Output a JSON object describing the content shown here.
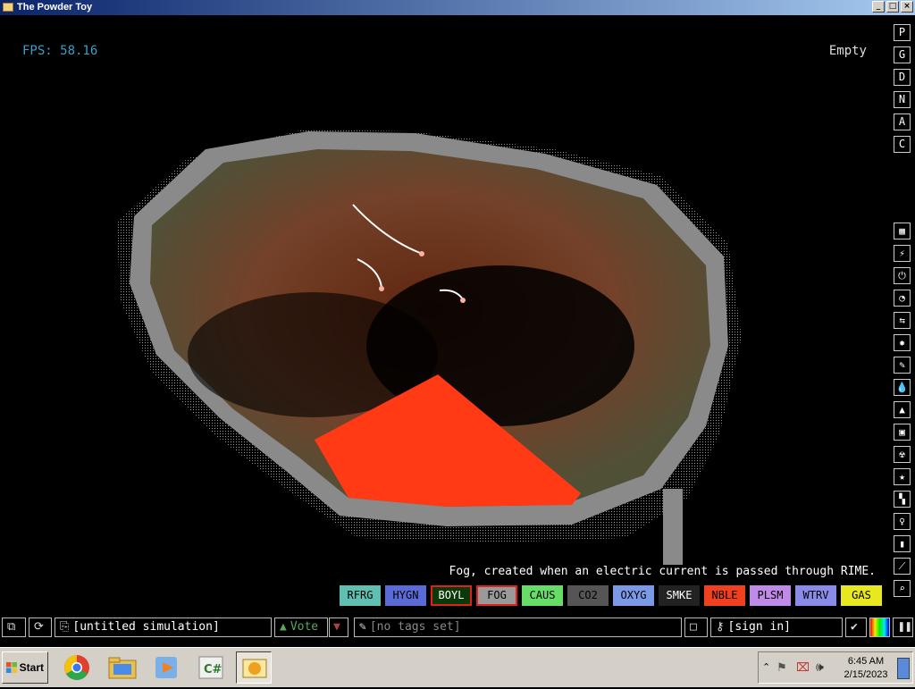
{
  "window": {
    "title": "The Powder Toy",
    "min_label": "_",
    "max_label": "□",
    "close_label": "×"
  },
  "hud": {
    "fps": "FPS: 58.16",
    "status": "Empty"
  },
  "render_modes": [
    "P",
    "G",
    "D",
    "N",
    "A",
    "C"
  ],
  "tool_icons": [
    "walls-icon",
    "electronics-icon",
    "powered-icon",
    "sensors-icon",
    "force-icon",
    "explosives-icon",
    "gases-icon",
    "liquids-icon",
    "powders-icon",
    "solids-icon",
    "radioactive-icon",
    "special-icon",
    "life-icon",
    "tools-icon",
    "favorites-icon",
    "decoration-icon",
    "search-icon"
  ],
  "element_description": {
    "before": "Fog, created when an electric ",
    "underlined": "current",
    "after": " is passed through RIME."
  },
  "elements": [
    {
      "name": "RFRG",
      "color": "#5fbfb0",
      "text": "#000"
    },
    {
      "name": "HYGN",
      "color": "#5a6bd8",
      "text": "#000"
    },
    {
      "name": "BOYL",
      "color": "#0a3a0a",
      "text": "#ffffff"
    },
    {
      "name": "FOG",
      "color": "#9a9a9a",
      "text": "#000"
    },
    {
      "name": "CAUS",
      "color": "#66dd66",
      "text": "#000"
    },
    {
      "name": "CO2",
      "color": "#555555",
      "text": "#000"
    },
    {
      "name": "OXYG",
      "color": "#7a9ae8",
      "text": "#000"
    },
    {
      "name": "SMKE",
      "color": "#222222",
      "text": "#ffffff"
    },
    {
      "name": "NBLE",
      "color": "#f04020",
      "text": "#000"
    },
    {
      "name": "PLSM",
      "color": "#c08ae8",
      "text": "#000"
    },
    {
      "name": "WTRV",
      "color": "#8a8ae8",
      "text": "#000"
    },
    {
      "name": "GAS",
      "color": "#e8e820",
      "text": "#000"
    }
  ],
  "bottombar": {
    "save_name": "[untitled simulation]",
    "vote": "Vote",
    "tags": "[no tags set]",
    "signin": "[sign in]"
  },
  "taskbar": {
    "start": "Start",
    "time": "6:45 AM",
    "date": "2/15/2023",
    "apps": [
      "chrome-icon",
      "folder-icon",
      "media-player-icon",
      "csharp-icon",
      "powder-toy-icon"
    ]
  }
}
